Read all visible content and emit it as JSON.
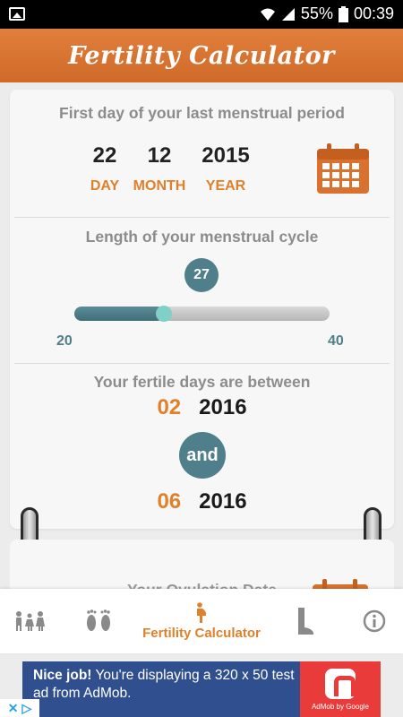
{
  "status_bar": {
    "battery_percent": "55%",
    "time": "00:39"
  },
  "header": {
    "title": "Fertility Calculator"
  },
  "last_period": {
    "title": "First day of your last menstrual period",
    "day": "22",
    "month": "12",
    "year": "2015",
    "day_label": "DAY",
    "month_label": "MONTH",
    "year_label": "YEAR"
  },
  "cycle": {
    "title": "Length of your menstrual cycle",
    "value": "27",
    "min": "20",
    "max": "40"
  },
  "fertile": {
    "title": "Your fertile days are between",
    "start_day": "02",
    "start_year": "2016",
    "and_label": "and",
    "end_day": "06",
    "end_year": "2016"
  },
  "ovulation": {
    "title": "Your Ovulation Date"
  },
  "nav": {
    "items": [
      {
        "icon": "family-icon",
        "label": ""
      },
      {
        "icon": "footprints-icon",
        "label": ""
      },
      {
        "icon": "pregnant-woman-icon",
        "label": "Fertility Calculator"
      },
      {
        "icon": "boot-icon",
        "label": ""
      },
      {
        "icon": "info-icon",
        "label": ""
      }
    ]
  },
  "ad": {
    "headline": "Nice job!",
    "body": " You're displaying a 320 x 50 test ad from AdMob.",
    "brand": "AdMob by Google"
  },
  "colors": {
    "accent": "#e0802a",
    "teal": "#4f7f8a",
    "header": "#d9722f"
  }
}
